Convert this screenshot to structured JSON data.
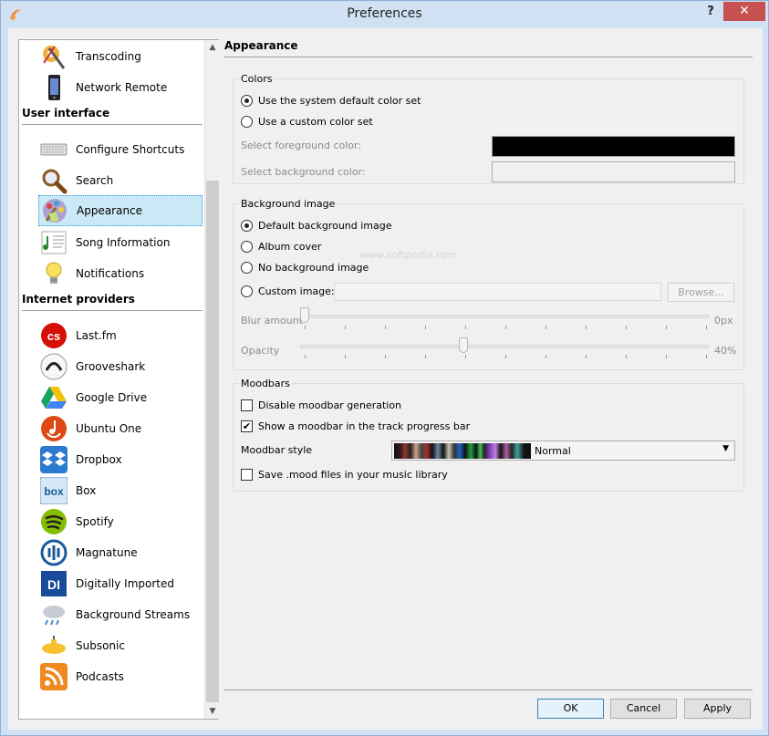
{
  "window": {
    "title": "Preferences",
    "help": "?",
    "close": "✕"
  },
  "sidebar": {
    "top_items": [
      {
        "label": "Transcoding",
        "icon": "transcoding-icon"
      },
      {
        "label": "Network Remote",
        "icon": "phone-icon"
      }
    ],
    "section_ui": "User interface",
    "ui_items": [
      {
        "label": "Configure Shortcuts",
        "icon": "keyboard-icon"
      },
      {
        "label": "Search",
        "icon": "magnifier-icon"
      },
      {
        "label": "Appearance",
        "icon": "palette-icon"
      },
      {
        "label": "Song Information",
        "icon": "music-note-icon"
      },
      {
        "label": "Notifications",
        "icon": "lightbulb-icon"
      }
    ],
    "section_providers": "Internet providers",
    "provider_items": [
      {
        "label": "Last.fm",
        "icon": "lastfm-icon"
      },
      {
        "label": "Grooveshark",
        "icon": "grooveshark-icon"
      },
      {
        "label": "Google Drive",
        "icon": "google-drive-icon"
      },
      {
        "label": "Ubuntu One",
        "icon": "ubuntu-one-icon"
      },
      {
        "label": "Dropbox",
        "icon": "dropbox-icon"
      },
      {
        "label": "Box",
        "icon": "box-icon"
      },
      {
        "label": "Spotify",
        "icon": "spotify-icon"
      },
      {
        "label": "Magnatune",
        "icon": "magnatune-icon"
      },
      {
        "label": "Digitally Imported",
        "icon": "digitally-imported-icon"
      },
      {
        "label": "Background Streams",
        "icon": "rain-cloud-icon"
      },
      {
        "label": "Subsonic",
        "icon": "submarine-icon"
      },
      {
        "label": "Podcasts",
        "icon": "rss-icon"
      }
    ]
  },
  "page": {
    "title": "Appearance"
  },
  "colors": {
    "group": "Colors",
    "opt_system": "Use the system default color set",
    "opt_custom": "Use a custom color set",
    "fg_label": "Select foreground color:",
    "bg_label": "Select background color:",
    "fg_color": "#000000",
    "bg_color": "#f0f0f0"
  },
  "background": {
    "group": "Background image",
    "opt_default": "Default background image",
    "opt_album": "Album cover",
    "opt_none": "No background image",
    "opt_custom": "Custom image:",
    "browse": "Browse...",
    "blur_label": "Blur amount",
    "blur_value": "0px",
    "opacity_label": "Opacity",
    "opacity_value": "40%",
    "watermark": "www.softpedia.com"
  },
  "moodbars": {
    "group": "Moodbars",
    "opt_disable": "Disable moodbar generation",
    "opt_show": "Show a moodbar in the track progress bar",
    "style_label": "Moodbar style",
    "style_value": "Normal",
    "opt_save": "Save .mood files in your music library"
  },
  "footer": {
    "ok": "OK",
    "cancel": "Cancel",
    "apply": "Apply"
  }
}
